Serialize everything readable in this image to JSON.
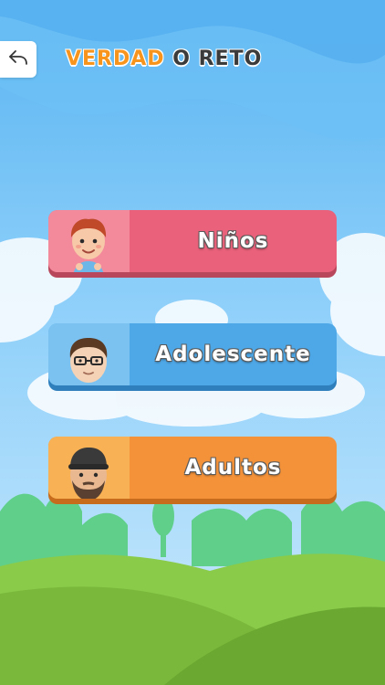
{
  "header": {
    "title_word1": "VERDAD",
    "title_word2": "O",
    "title_word3": "RETO",
    "back_icon": "reply-arrow-icon"
  },
  "categories": [
    {
      "label": "Niños",
      "avatar": "boy-avatar",
      "color": "#e9617a"
    },
    {
      "label": "Adolescente",
      "avatar": "teen-avatar-glasses",
      "color": "#4ea7e6"
    },
    {
      "label": "Adultos",
      "avatar": "adult-avatar-beard",
      "color": "#f49239"
    }
  ],
  "colors": {
    "sky_top": "#5bb8f3",
    "sky_bottom": "#bfe3fb",
    "grass": "#7cc243",
    "title_accent": "#f7941d"
  }
}
